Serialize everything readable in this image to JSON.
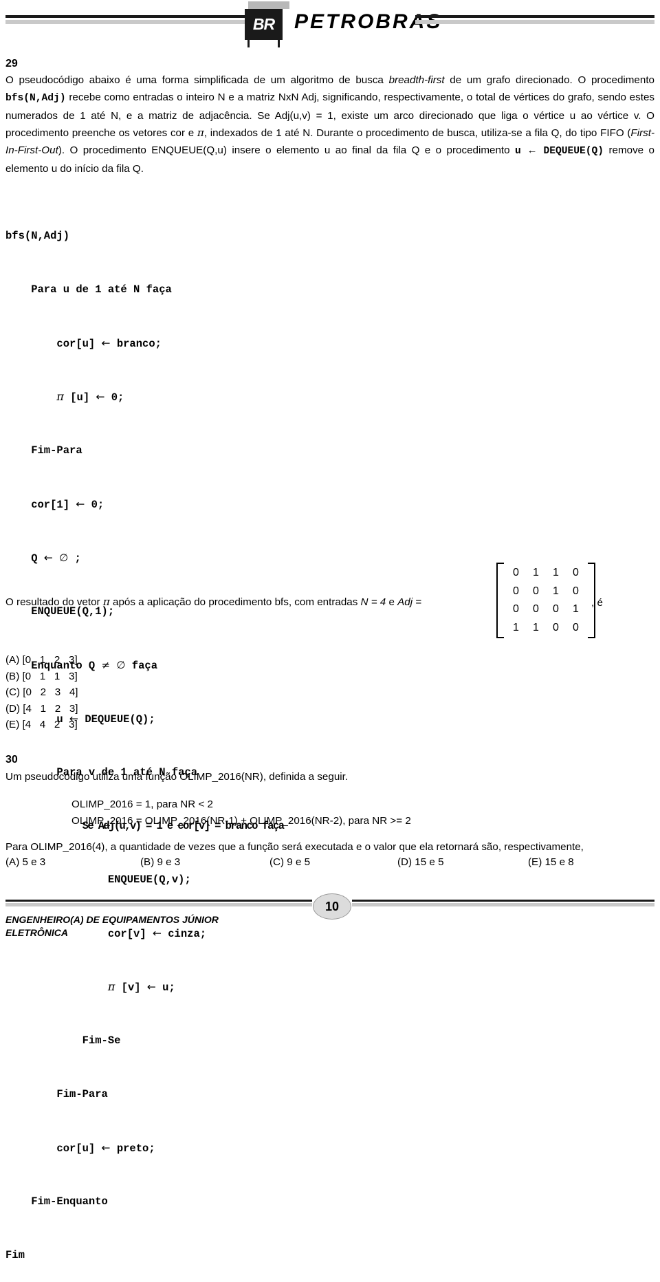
{
  "header": {
    "logo_mark": "BR",
    "logo_word": "PETROBRAS"
  },
  "question29": {
    "number": "29",
    "intro_lines": [
      "O pseudocódigo abaixo é uma forma simplificada de um algoritmo de busca breadth-first de um grafo direcionado. O",
      "procedimento bfs(N,Adj) recebe como entradas o inteiro N e a matriz NxN Adj, significando, respectivamente, o total de",
      "vértices do grafo, sendo estes numerados de 1 até N, e a matriz de adjacência. Se Adj(u,v) = 1, existe um arco direcionado",
      "que liga o vértice u ao vértice v. O procedimento preenche os vetores cor e π, indexados de 1 até N. Durante",
      "o procedimento de busca, utiliza-se a fila Q, do tipo FIFO (First-In-First-Out). O procedimento ENQUEUE(Q,u)",
      "insere o elemento u ao final da fila Q e o procedimento u ← DEQUEUE(Q) remove o elemento u do início da fila Q."
    ],
    "pseudocode": [
      "bfs(N,Adj)",
      "    Para u de 1 até N faça",
      "        cor[u] ← branco;",
      "        π [u] ← 0;",
      "    Fim-Para",
      "    cor[1] ← 0;",
      "    Q ← ∅ ;",
      "    ENQUEUE(Q,1);",
      "    Enquanto Q ≠ ∅ faça",
      "        u ← DEQUEUE(Q);",
      "        Para v de 1 até N faça",
      "            Se Adj(u,v) = 1 e cor[v] = branco faça",
      "                ENQUEUE(Q,v);",
      "                cor[v] ← cinza;",
      "                π [v] ← u;",
      "            Fim-Se",
      "        Fim-Para",
      "        cor[u] ← preto;",
      "    Fim-Enquanto",
      "Fim"
    ],
    "result_prefix": "O resultado do vetor π após a aplicação do procedimento bfs, com entradas ",
    "result_n": "N = 4",
    "result_mid": " e ",
    "result_adj_label": "Adj",
    "result_equals": " =",
    "result_suffix": ", é",
    "matrix": [
      [
        "0",
        "1",
        "1",
        "0"
      ],
      [
        "0",
        "0",
        "1",
        "0"
      ],
      [
        "0",
        "0",
        "0",
        "1"
      ],
      [
        "1",
        "1",
        "0",
        "0"
      ]
    ],
    "options": [
      "(A) [0   1   2   3]",
      "(B) [0   1   1   3]",
      "(C) [0   2   3   4]",
      "(D) [4   1   2   3]",
      "(E) [4   4   2   3]"
    ]
  },
  "question30": {
    "number": "30",
    "intro": "Um pseudocódigo utiliza uma função OLIMP_2016(NR), definida a seguir.",
    "definition_lines": [
      "OLIMP_2016 = 1, para NR < 2",
      "OLIMP_2016 = OLIMP_2016(NR-1) + OLIMP_2016(NR-2), para NR >= 2"
    ],
    "prompt": "Para OLIMP_2016(4), a quantidade de vezes que a função será executada e o valor que ela retornará são, respectivamente,",
    "options": [
      "(A) 5 e 3",
      "(B) 9 e 3",
      "(C) 9 e 5",
      "(D) 15 e 5",
      "(E) 15 e 8"
    ]
  },
  "footer": {
    "page_number": "10",
    "role_line1": "ENGENHEIRO(A) DE EQUIPAMENTOS JÚNIOR",
    "role_line2": "ELETRÔNICA"
  }
}
